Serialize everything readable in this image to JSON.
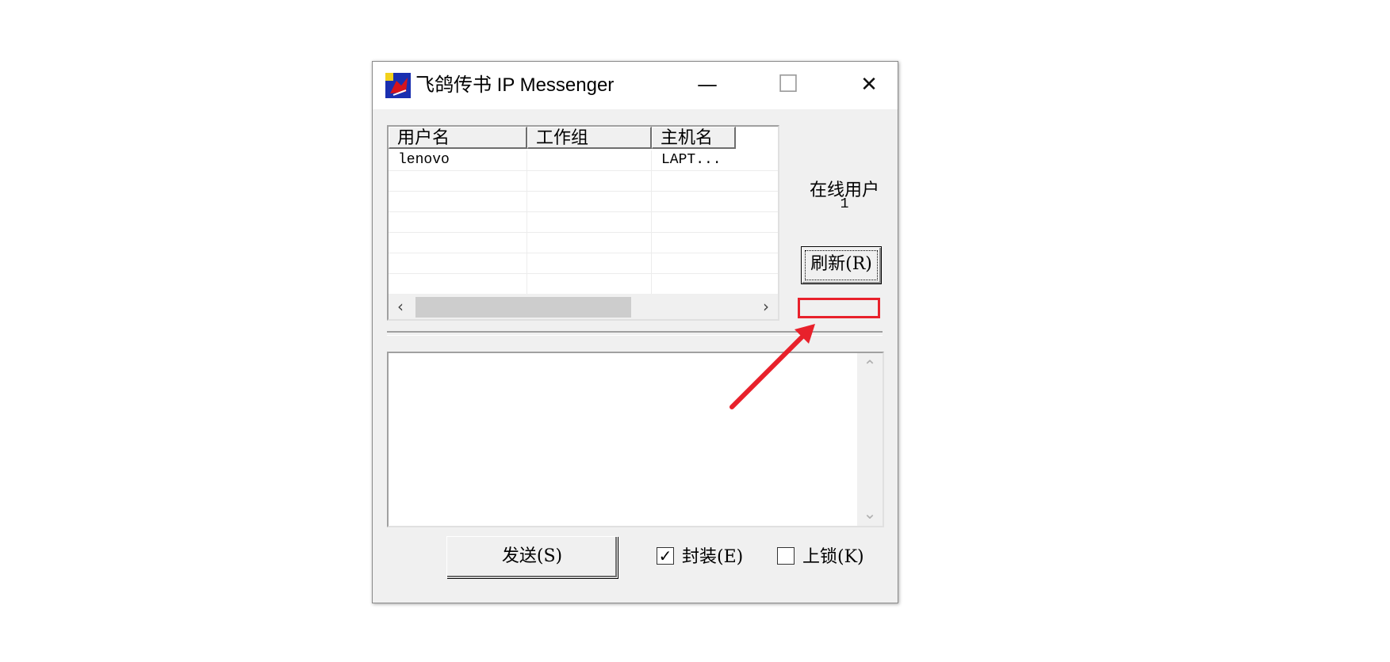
{
  "window": {
    "title": "飞鸽传书  IP Messenger",
    "minimize_glyph": "—",
    "maximize_glyph": "☐",
    "close_glyph": "✕"
  },
  "list": {
    "columns": [
      "用户名",
      "工作组",
      "主机名"
    ],
    "rows": [
      [
        "lenovo",
        "",
        "LAPT..."
      ]
    ],
    "scroll_left_glyph": "‹",
    "scroll_right_glyph": "›"
  },
  "status": {
    "online_label": "在线用户",
    "online_count": "1"
  },
  "buttons": {
    "refresh_label": "刷新(R)",
    "send_label": "发送(S)"
  },
  "options": {
    "seal_label": "封装(E)",
    "seal_checked": true,
    "lock_label": "上锁(K)",
    "lock_checked": false,
    "check_glyph": "✓"
  },
  "message": {
    "scroll_up_glyph": "⌃",
    "scroll_down_glyph": "⌄"
  },
  "annotation": {
    "color": "#e8212b"
  }
}
